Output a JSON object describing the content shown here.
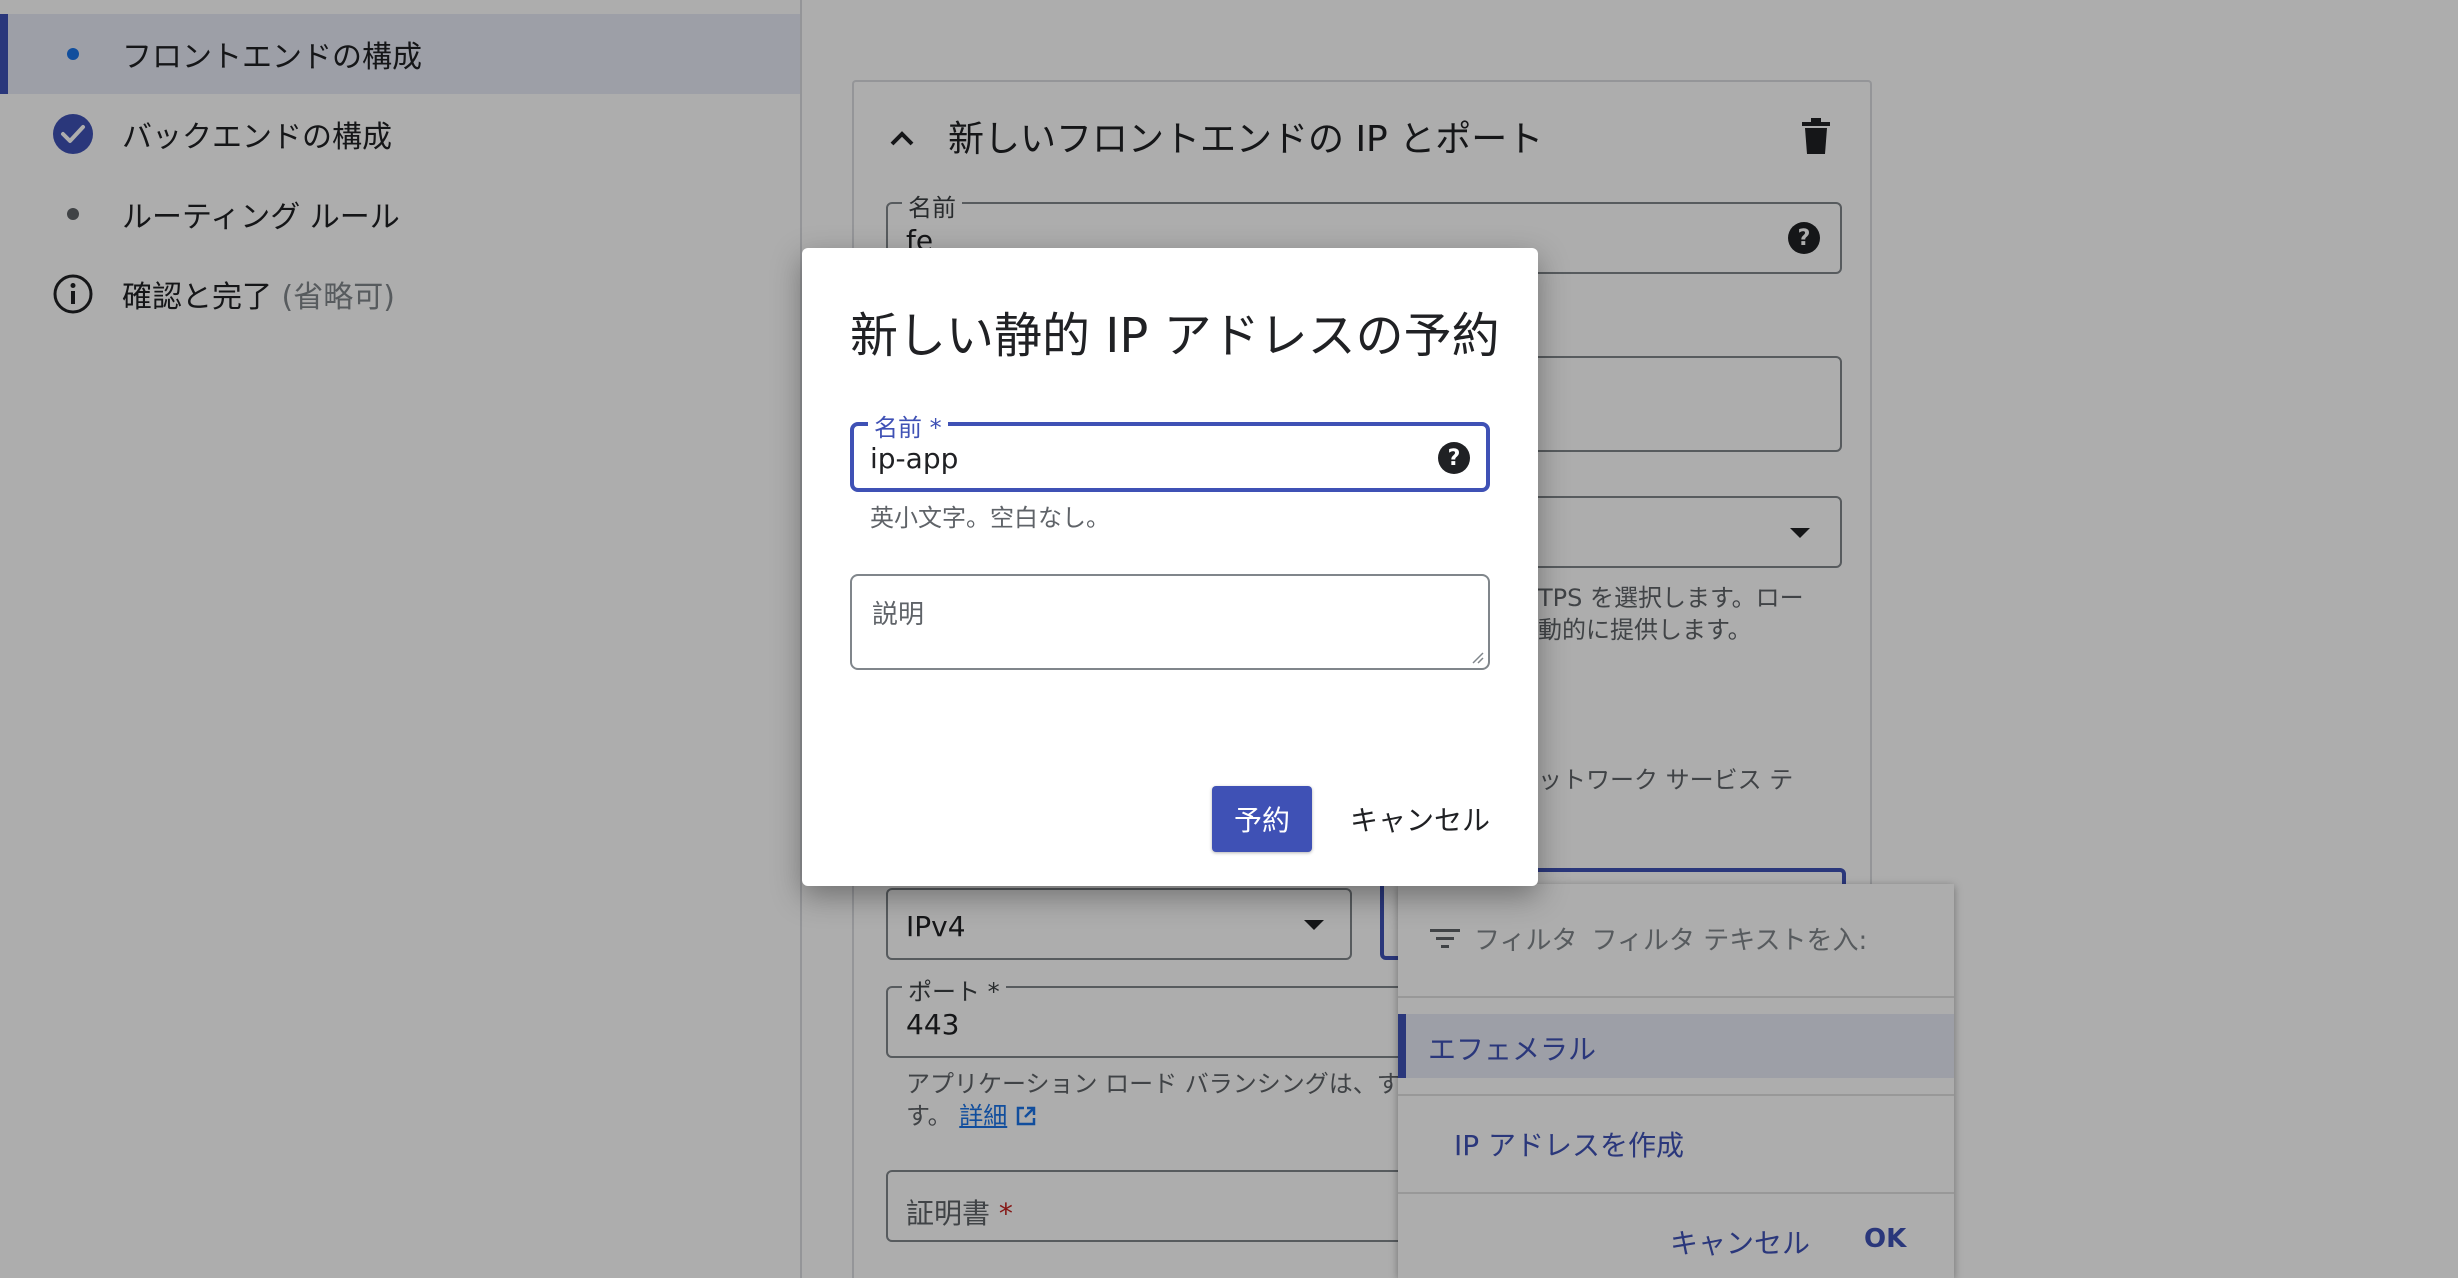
{
  "sidebar": {
    "steps": [
      {
        "label": "フロントエンドの構成"
      },
      {
        "label": "バックエンドの構成"
      },
      {
        "label": "ルーティング ルール"
      },
      {
        "label": "確認と完了",
        "suffix": "(省略可)"
      }
    ]
  },
  "card": {
    "title": "新しいフロントエンドの IP とポート",
    "name_label": "名前",
    "name_value": "fe",
    "protocol_hint_line1": "TPS を選択します。ロー",
    "protocol_hint_line2": "動的に提供します。",
    "network_hint": "ットワーク サービス テ",
    "ip_version_value": "IPv4",
    "port_label": "ポート",
    "port_required": "*",
    "port_value": "443",
    "port_hint_line1": "アプリケーション ロード バランシングは、す",
    "port_hint_line2": "す。",
    "details_link": "詳細",
    "cert_label": "証明書",
    "cert_required": "*"
  },
  "menu": {
    "filter_label": "フィルタ",
    "filter_placeholder": "フィルタ テキストを入:",
    "selected_item": "エフェメラル",
    "create_item": "IP アドレスを作成",
    "cancel_label": "キャンセル",
    "ok_label": "OK"
  },
  "dialog": {
    "title": "新しい静的 IP アドレスの予約",
    "name_label": "名前 *",
    "name_value": "ip-app",
    "name_hint": "英小文字。空白なし。",
    "description_placeholder": "説明",
    "reserve_label": "予約",
    "cancel_label": "キャンセル"
  },
  "icons": {
    "check": "check-circle-icon",
    "info": "info-icon",
    "help": "help-icon",
    "delete": "trash-icon",
    "collapse": "chevron-up-icon",
    "filter": "filter-icon",
    "external": "external-link-icon"
  },
  "colors": {
    "accent": "#3f51b5",
    "link": "#1a73e8"
  }
}
